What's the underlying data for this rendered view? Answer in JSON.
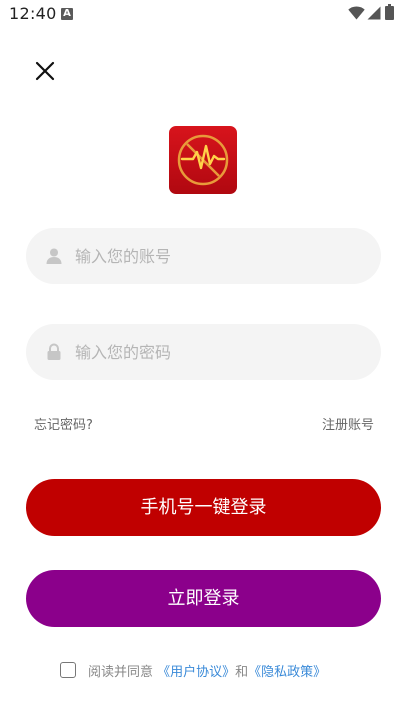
{
  "status_bar": {
    "time": "12:40",
    "notification_letter": "A"
  },
  "form": {
    "account_placeholder": "输入您的账号",
    "password_placeholder": "输入您的密码",
    "forgot_label": "忘记密码?",
    "register_label": "注册账号"
  },
  "buttons": {
    "phone_login_label": "手机号一键登录",
    "login_label": "立即登录"
  },
  "agreement": {
    "prefix": "阅读并同意 ",
    "user_agreement": "《用户协议》",
    "conjunction": "和",
    "privacy_policy": "《隐私政策》"
  },
  "colors": {
    "phone_login_button": "#c00000",
    "login_button": "#8b008b",
    "link": "#3a8ad8",
    "logo_background": "#c8141e"
  },
  "icons": {
    "close": "close-icon",
    "user": "user-icon",
    "lock": "lock-icon",
    "logo": "heartbeat-logo"
  }
}
